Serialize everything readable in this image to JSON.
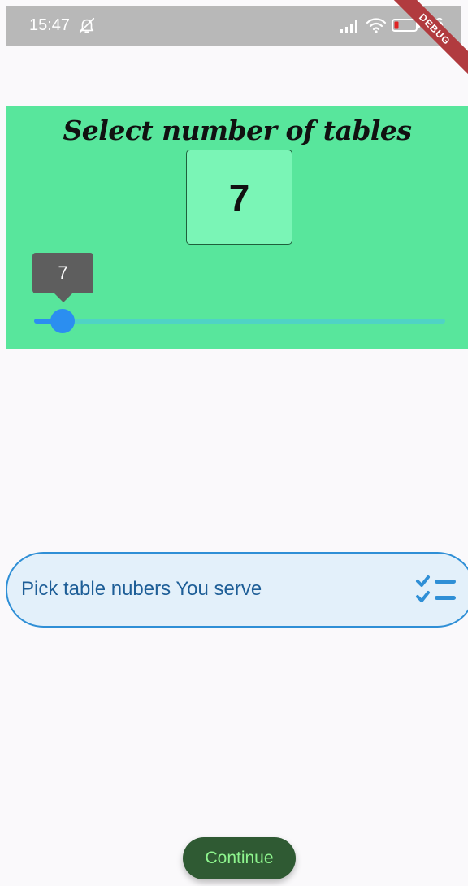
{
  "status_bar": {
    "time": "15:47",
    "battery_text": "16",
    "icons": [
      "bell-off-icon",
      "signal-icon",
      "wifi-icon",
      "battery-icon"
    ]
  },
  "debug_banner": "DEBUG",
  "table_selector": {
    "title": "Select number of tables",
    "count": "7",
    "slider": {
      "value": 7,
      "tooltip": "7",
      "fraction": 0.07
    }
  },
  "pick_field": {
    "label": "Pick table nubers You serve",
    "icon": "checklist-icon"
  },
  "continue_button": {
    "label": "Continue"
  },
  "colors": {
    "panel": "#58e69c",
    "count_box": "#7af5b6",
    "slider_active": "#2b8ef0",
    "slider_inactive": "#4fd3c5",
    "field_border": "#2f8fd6",
    "button_bg": "#2f5a33",
    "button_text": "#8ef58e"
  }
}
